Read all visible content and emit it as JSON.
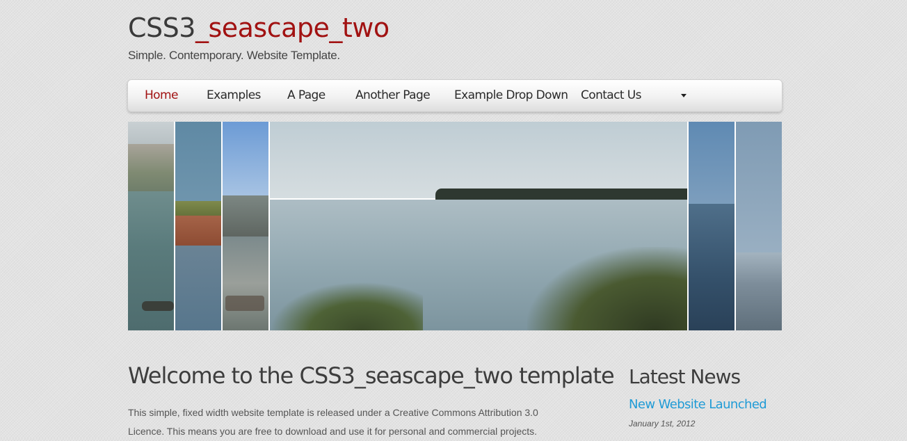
{
  "site": {
    "logo_part1": "CSS3",
    "logo_part2": "_seascape_two",
    "slogan": "Simple. Contemporary. Website Template."
  },
  "menu": {
    "items": [
      {
        "label": "Home",
        "active": true
      },
      {
        "label": "Examples"
      },
      {
        "label": "A Page"
      },
      {
        "label": "Another Page"
      },
      {
        "label": "Example Drop Down",
        "has_dropdown": true
      },
      {
        "label": "Contact Us"
      }
    ]
  },
  "colors": {
    "accent": "#a11212",
    "link": "#1f9bd6",
    "text": "#444444"
  },
  "slideshow": {
    "panels": [
      "coastal cliff and sea",
      "red clay cliff over still water",
      "rocky shoreline",
      "calm sea with headland and shrubs",
      "deep blue sea",
      "sparkling sea"
    ]
  },
  "content": {
    "heading": "Welcome to the CSS3_seascape_two template",
    "paragraph": "This simple, fixed width website template is released under a Creative Commons Attribution 3.0 Licence. This means you are free to download and use it for personal and commercial projects."
  },
  "sidebar": {
    "heading": "Latest News",
    "news": [
      {
        "title": "New Website Launched",
        "date": "January 1st, 2012"
      }
    ]
  }
}
